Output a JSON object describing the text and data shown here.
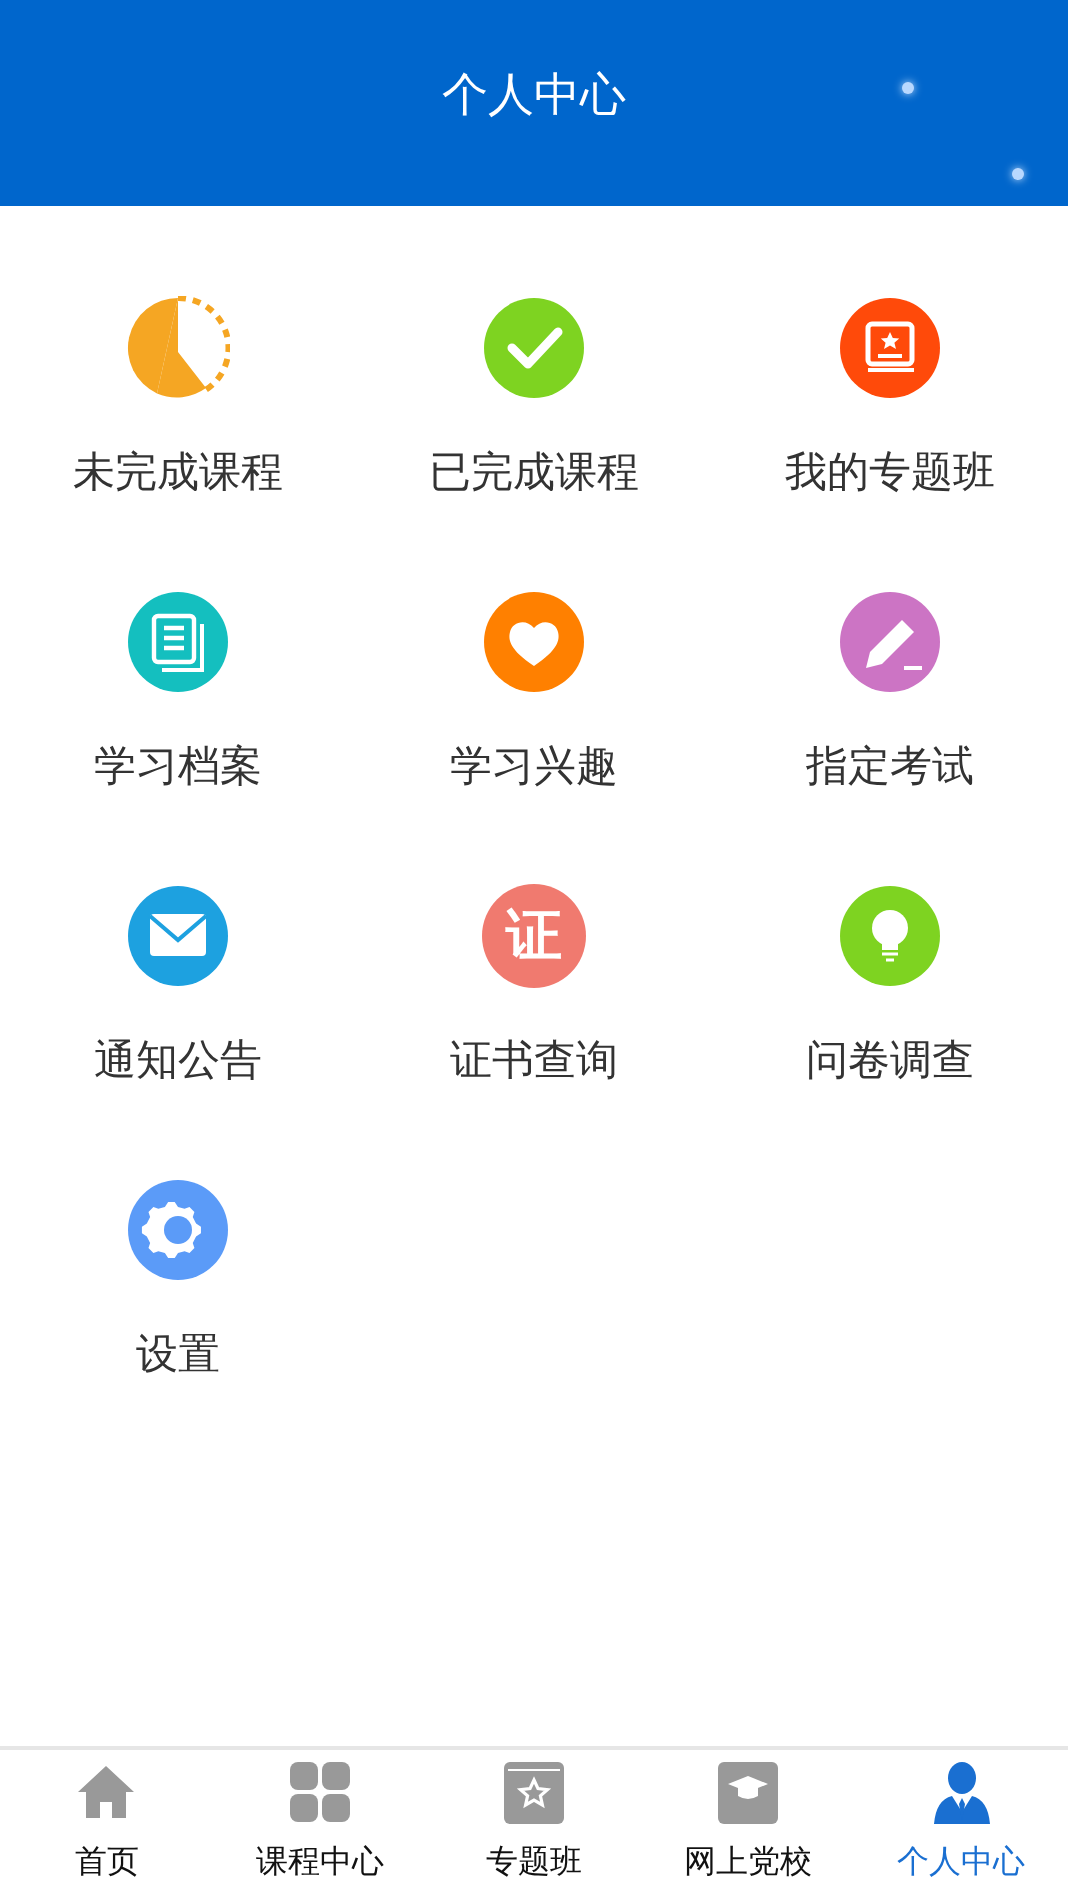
{
  "header": {
    "title": "个人中心"
  },
  "menu": [
    {
      "label": "未完成课程",
      "kind": "pie",
      "color": "#f5a623"
    },
    {
      "label": "已完成课程",
      "kind": "check",
      "color": "#7ed321"
    },
    {
      "label": "我的专题班",
      "kind": "book",
      "color": "#ff4a0a"
    },
    {
      "label": "学习档案",
      "kind": "docs",
      "color": "#14bfbf"
    },
    {
      "label": "学习兴趣",
      "kind": "heart",
      "color": "#ff8000"
    },
    {
      "label": "指定考试",
      "kind": "pencil",
      "color": "#cc74c4"
    },
    {
      "label": "通知公告",
      "kind": "mail",
      "color": "#1da1e0"
    },
    {
      "label": "证书查询",
      "kind": "glyph",
      "color": "#f07a6f",
      "glyph": "证"
    },
    {
      "label": "问卷调查",
      "kind": "bulb",
      "color": "#7ed321"
    },
    {
      "label": "设置",
      "kind": "gear",
      "color": "#5b9bf8"
    }
  ],
  "tabbar": [
    {
      "label": "首页",
      "kind": "home",
      "selected": false
    },
    {
      "label": "课程中心",
      "kind": "grid",
      "selected": false
    },
    {
      "label": "专题班",
      "kind": "book",
      "selected": false
    },
    {
      "label": "网上党校",
      "kind": "cap",
      "selected": false
    },
    {
      "label": "个人中心",
      "kind": "person",
      "selected": true
    }
  ]
}
